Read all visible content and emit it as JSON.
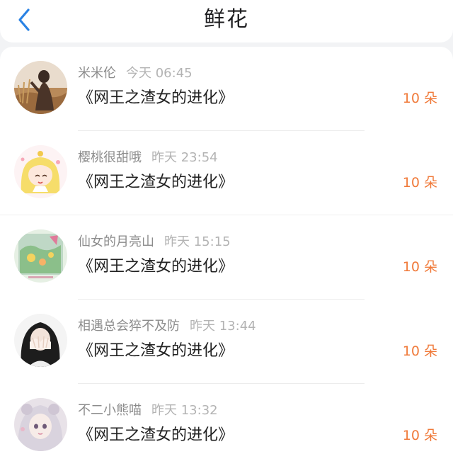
{
  "header": {
    "title": "鲜花"
  },
  "rows": [
    {
      "user": "米米伦",
      "time": "今天 06:45",
      "book": "《网王之渣女的进化》",
      "amount": "10 朵"
    },
    {
      "user": "樱桃很甜哦",
      "time": "昨天 23:54",
      "book": "《网王之渣女的进化》",
      "amount": "10 朵"
    },
    {
      "user": "仙女的月亮山",
      "time": "昨天 15:15",
      "book": "《网王之渣女的进化》",
      "amount": "10 朵"
    },
    {
      "user": "相遇总会猝不及防",
      "time": "昨天 13:44",
      "book": "《网王之渣女的进化》",
      "amount": "10 朵"
    },
    {
      "user": "不二小熊喵",
      "time": "昨天 13:32",
      "book": "《网王之渣女的进化》",
      "amount": "10 朵"
    }
  ],
  "colors": {
    "accent": "#f07a3a",
    "back_icon": "#2a82e4"
  },
  "icons": {
    "back": "chevron-left-icon"
  }
}
